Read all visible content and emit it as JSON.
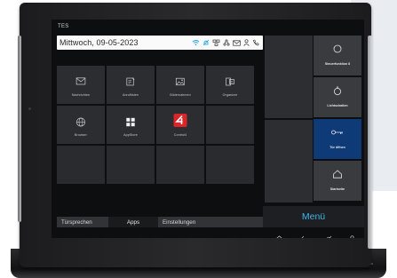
{
  "device": {
    "brand": "TES"
  },
  "statusbar": {
    "date": "Mittwoch, 09-05-2023",
    "icons": [
      "wifi-icon",
      "bell-icon",
      "network-icon",
      "share-icon",
      "mail-icon",
      "person-icon",
      "phone-icon"
    ],
    "accent": "#1aa3d9"
  },
  "apps": [
    {
      "label": "Nachrichten",
      "icon": "mail-icon"
    },
    {
      "label": "Anruflisten",
      "icon": "calllist-icon"
    },
    {
      "label": "Bildernahmen",
      "icon": "image-icon"
    },
    {
      "label": "Organizer",
      "icon": "organizer-icon"
    },
    {
      "label": "Browser",
      "icon": "globe-icon"
    },
    {
      "label": "AppStore",
      "icon": "appstore-icon"
    },
    {
      "label": "Control4",
      "icon": "control4-icon"
    }
  ],
  "tabs": {
    "doorphone": "Türsprechen",
    "apps": "Apps",
    "settings": "Einstellungen"
  },
  "side_buttons": [
    {
      "label": "Steuerfunktion 8",
      "icon": "circle-icon"
    },
    {
      "label": "Lichtschalten",
      "icon": "bulb-icon"
    },
    {
      "label": "Tür öffnen",
      "icon": "key-icon"
    },
    {
      "label": "Startseite",
      "icon": "home-icon"
    }
  ],
  "menu_label": "Menü",
  "nav_icons": [
    "home-icon",
    "back-icon",
    "bell-icon",
    "person-icon"
  ],
  "colors": {
    "active_button": "#0f3a78",
    "menu_text": "#3fb5e7",
    "control4_red": "#d9262a"
  }
}
